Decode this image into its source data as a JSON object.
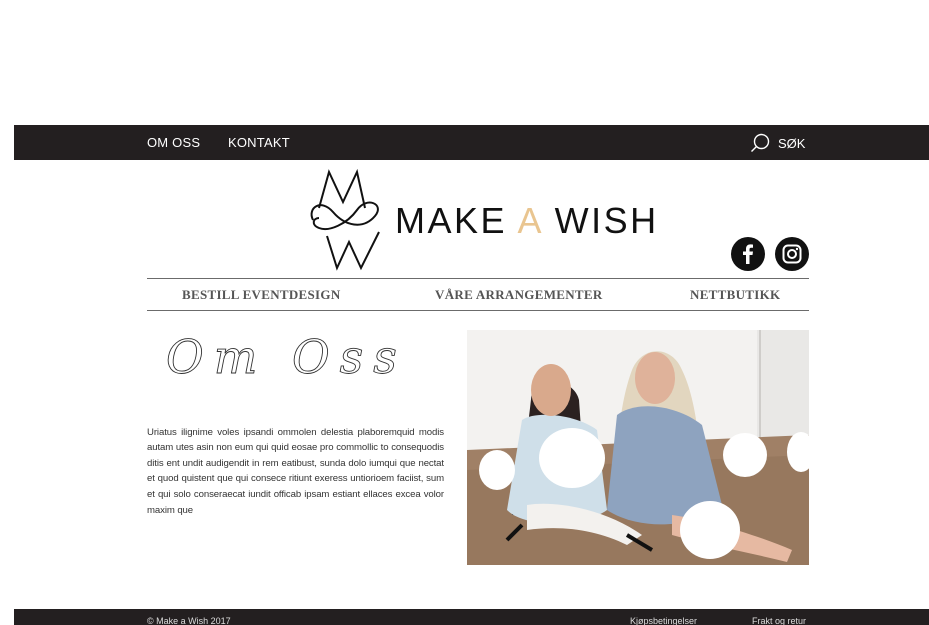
{
  "nav": {
    "about": "OM OSS",
    "contact": "KONTAKT",
    "search": "SØK"
  },
  "logo": {
    "word1": "MAKE",
    "word2": "A",
    "word3": "WISH",
    "accent_color": "#e9c590"
  },
  "menu": {
    "items": [
      "BESTILL EVENTDESIGN",
      "VÅRE ARRANGEMENTER",
      "NETTBUTIKK"
    ]
  },
  "about": {
    "heading": "Om Oss",
    "body": "Uriatus ilignime voles ipsandi ommolen delestia plaboremquid modis autam utes asin non eum qui quid eosae pro commollic to consequodis ditis ent undit audigendit in rem eatibust, sunda dolo iumqui que nectat et quod quistent que qui consece ritiunt exeress untiorioem faciist, sum et qui solo conseraecat iundit officab ipsam estiant ellaces excea volor maxim que"
  },
  "footer": {
    "copyright": "© Make a Wish 2017",
    "terms": "Kjøpsbetingelser",
    "shipping": "Frakt og retur"
  },
  "colors": {
    "bar": "#231f20",
    "accent": "#e9c590"
  },
  "icons": [
    "search-icon",
    "facebook-icon",
    "instagram-icon"
  ]
}
